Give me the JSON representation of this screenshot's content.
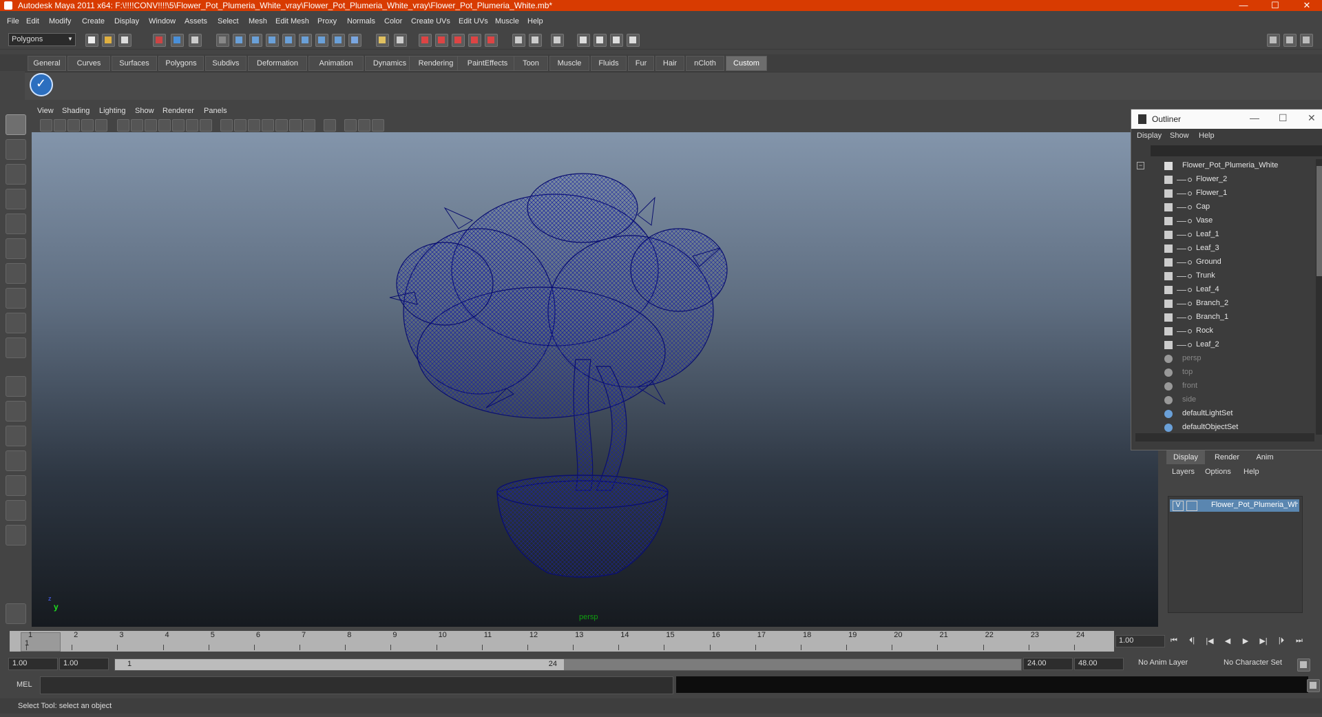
{
  "window": {
    "title": "Autodesk Maya 2011 x64: F:\\!!!!CONV!!!!\\5\\Flower_Pot_Plumeria_White_vray\\Flower_Pot_Plumeria_White_vray\\Flower_Pot_Plumeria_White.mb*",
    "min": "—",
    "max": "☐",
    "close": "✕"
  },
  "menubar": [
    "File",
    "Edit",
    "Modify",
    "Create",
    "Display",
    "Window",
    "Assets",
    "Select",
    "Mesh",
    "Edit Mesh",
    "Proxy",
    "Normals",
    "Color",
    "Create UVs",
    "Edit UVs",
    "Muscle",
    "Help"
  ],
  "mode_selector": "Polygons",
  "shelf_tabs": [
    "General",
    "Curves",
    "Surfaces",
    "Polygons",
    "Subdivs",
    "Deformation",
    "Animation",
    "Dynamics",
    "Rendering",
    "PaintEffects",
    "Toon",
    "Muscle",
    "Fluids",
    "Fur",
    "Hair",
    "nCloth",
    "Custom"
  ],
  "active_shelf_tab": "Custom",
  "viewport": {
    "menu": [
      "View",
      "Shading",
      "Lighting",
      "Show",
      "Renderer",
      "Panels"
    ],
    "camera_label": "persp",
    "axis_y": "y",
    "axis_z": "z",
    "wireframe_color": "#0a0f6e"
  },
  "outliner": {
    "title": "Outliner",
    "menu": [
      "Display",
      "Show",
      "Help"
    ],
    "root": "Flower_Pot_Plumeria_White",
    "children": [
      "Flower_2",
      "Flower_1",
      "Cap",
      "Vase",
      "Leaf_1",
      "Leaf_3",
      "Ground",
      "Trunk",
      "Leaf_4",
      "Branch_2",
      "Branch_1",
      "Rock",
      "Leaf_2"
    ],
    "cameras": [
      "persp",
      "top",
      "front",
      "side"
    ],
    "sets": [
      "defaultLightSet",
      "defaultObjectSet"
    ]
  },
  "layer_editor": {
    "tabs": [
      "Display",
      "Render",
      "Anim"
    ],
    "active_tab": "Display",
    "menu": [
      "Layers",
      "Options",
      "Help"
    ],
    "layer": {
      "visible": "V",
      "name": "Flower_Pot_Plumeria_White"
    }
  },
  "timeline": {
    "ticks": [
      "1",
      "2",
      "3",
      "4",
      "5",
      "6",
      "7",
      "8",
      "9",
      "10",
      "11",
      "12",
      "13",
      "14",
      "15",
      "16",
      "17",
      "18",
      "19",
      "20",
      "21",
      "22",
      "23",
      "24"
    ],
    "current_frame": "1",
    "frame_field": "1.00"
  },
  "range": {
    "start": "1.00",
    "inner_start": "1.00",
    "slider_start": "1",
    "slider_end": "24",
    "end": "24.00",
    "outer_end": "48.00",
    "anim_layer": "No Anim Layer",
    "character_set": "No Character Set"
  },
  "command": {
    "label": "MEL"
  },
  "help_line": "Select Tool: select an object"
}
